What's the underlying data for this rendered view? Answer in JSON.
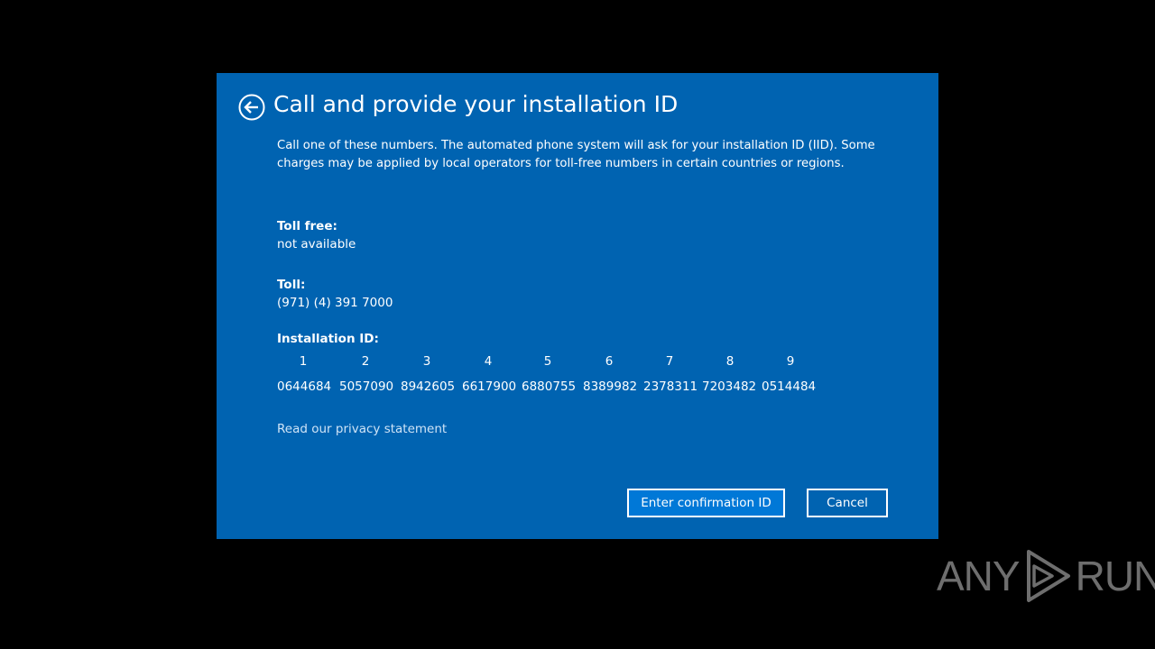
{
  "dialog": {
    "title": "Call and provide your installation ID",
    "description": "Call one of these numbers. The automated phone system will ask for your installation ID (IID). Some charges may be applied by local operators for toll-free numbers in certain countries or regions.",
    "toll_free": {
      "label": "Toll free:",
      "value": "not available"
    },
    "toll": {
      "label": "Toll:",
      "value": "(971) (4) 391 7000"
    },
    "installation_id": {
      "label": "Installation ID:",
      "groups": [
        {
          "index": "1",
          "code": "0644684"
        },
        {
          "index": "2",
          "code": "5057090"
        },
        {
          "index": "3",
          "code": "8942605"
        },
        {
          "index": "4",
          "code": "6617900"
        },
        {
          "index": "5",
          "code": "6880755"
        },
        {
          "index": "6",
          "code": "8389982"
        },
        {
          "index": "7",
          "code": "2378311"
        },
        {
          "index": "8",
          "code": "7203482"
        },
        {
          "index": "9",
          "code": "0514484"
        }
      ]
    },
    "privacy_link": "Read our privacy statement",
    "buttons": {
      "primary": "Enter confirmation ID",
      "secondary": "Cancel"
    }
  },
  "watermark": {
    "left_text": "ANY",
    "right_text": "RUN"
  },
  "colors": {
    "dialog_bg": "#0063b1",
    "primary_button_bg": "#0078d7",
    "backdrop": "#000000",
    "watermark": "#6e6e6e"
  },
  "icons": {
    "back": "back-arrow-circle-icon",
    "watermark_logo": "play-triangle-icon"
  }
}
